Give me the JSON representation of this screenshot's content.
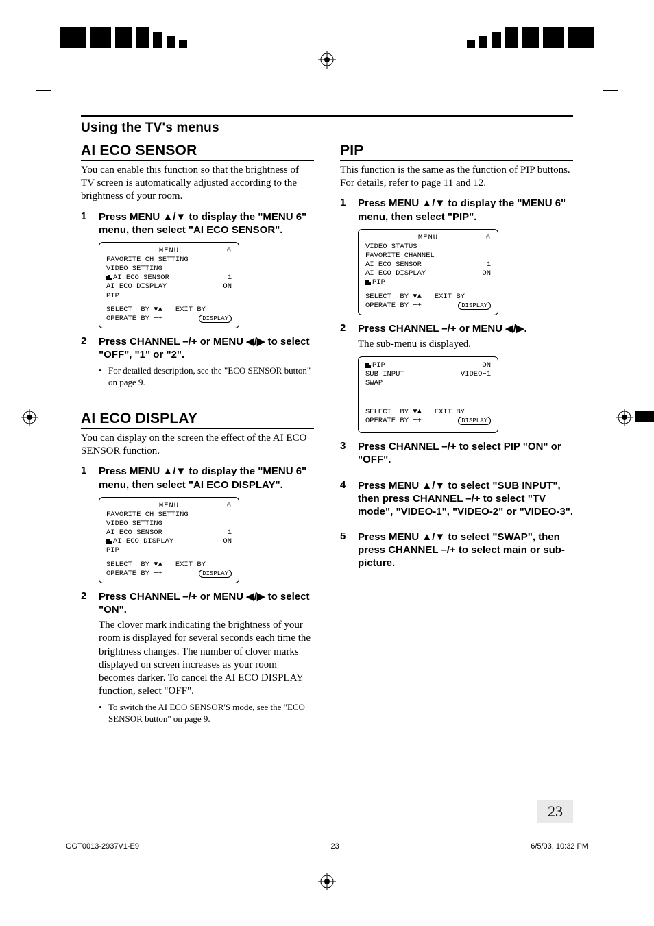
{
  "section_header": "Using the TV's menus",
  "left": {
    "ai_eco_sensor": {
      "title": "AI ECO SENSOR",
      "intro": "You can enable this function so that the brightness of TV screen is automatically adjusted according to the brightness of your room.",
      "step1": {
        "num": "1",
        "head": "Press MENU ▲/▼ to display the \"MENU 6\" menu, then select \"AI ECO SENSOR\"."
      },
      "osd1": {
        "title": "MENU",
        "page": "6",
        "items": [
          {
            "l": "FAVORITE CH SETTING",
            "r": ""
          },
          {
            "l": "VIDEO SETTING",
            "r": ""
          },
          {
            "l": "AI ECO SENSOR",
            "r": "1",
            "pointer": true
          },
          {
            "l": "AI ECO DISPLAY",
            "r": "ON"
          },
          {
            "l": "PIP",
            "r": ""
          }
        ],
        "foot1": "SELECT  BY ▼▲   EXIT BY",
        "foot2_l": "OPERATE BY −+",
        "foot2_r": "DISPLAY"
      },
      "step2": {
        "num": "2",
        "head": "Press CHANNEL –/+ or MENU ◀/▶ to select \"OFF\", \"1\" or \"2\"."
      },
      "bullet": "For detailed description, see the \"ECO SENSOR button\" on page 9."
    },
    "ai_eco_display": {
      "title": "AI ECO DISPLAY",
      "intro": "You can display on the screen the effect of the AI ECO SENSOR function.",
      "step1": {
        "num": "1",
        "head": "Press MENU ▲/▼ to display the \"MENU 6\" menu, then select \"AI ECO DISPLAY\"."
      },
      "osd1": {
        "title": "MENU",
        "page": "6",
        "items": [
          {
            "l": "FAVORITE CH SETTING",
            "r": ""
          },
          {
            "l": "VIDEO SETTING",
            "r": ""
          },
          {
            "l": "AI ECO SENSOR",
            "r": "1"
          },
          {
            "l": "AI ECO DISPLAY",
            "r": "ON",
            "pointer": true
          },
          {
            "l": "PIP",
            "r": ""
          }
        ],
        "foot1": "SELECT  BY ▼▲   EXIT BY",
        "foot2_l": "OPERATE BY −+",
        "foot2_r": "DISPLAY"
      },
      "step2": {
        "num": "2",
        "head": "Press CHANNEL –/+ or MENU ◀/▶ to select \"ON\".",
        "desc": "The clover mark indicating the brightness of your room is displayed for several seconds each time the brightness changes. The number of clover marks displayed on screen increases as your room becomes darker. To cancel the AI ECO DISPLAY function, select \"OFF\"."
      },
      "bullet": "To switch the AI ECO SENSOR'S mode, see the \"ECO SENSOR button\" on page 9."
    }
  },
  "right": {
    "pip": {
      "title": "PIP",
      "intro": "This function is the same as the function of PIP buttons. For details, refer to page 11 and 12.",
      "step1": {
        "num": "1",
        "head": "Press MENU ▲/▼ to display the \"MENU 6\" menu, then select \"PIP\"."
      },
      "osd1": {
        "title": "MENU",
        "page": "6",
        "items": [
          {
            "l": "VIDEO STATUS",
            "r": ""
          },
          {
            "l": "FAVORITE CHANNEL",
            "r": ""
          },
          {
            "l": "AI ECO SENSOR",
            "r": "1"
          },
          {
            "l": "AI ECO DISPLAY",
            "r": "ON"
          },
          {
            "l": "PIP",
            "r": "",
            "pointer": true
          }
        ],
        "foot1": "SELECT  BY ▼▲   EXIT BY",
        "foot2_l": "OPERATE BY −+",
        "foot2_r": "DISPLAY"
      },
      "step2": {
        "num": "2",
        "head": "Press CHANNEL –/+ or MENU ◀/▶.",
        "desc": "The sub-menu is displayed."
      },
      "osd2": {
        "items": [
          {
            "l": "PIP",
            "r": "ON",
            "pointer": true
          },
          {
            "l": "SUB INPUT",
            "r": "VIDEO−1"
          },
          {
            "l": "SWAP",
            "r": ""
          }
        ],
        "foot1": "SELECT  BY ▼▲   EXIT BY",
        "foot2_l": "OPERATE BY −+",
        "foot2_r": "DISPLAY"
      },
      "step3": {
        "num": "3",
        "head": "Press CHANNEL –/+ to select PIP \"ON\" or \"OFF\"."
      },
      "step4": {
        "num": "4",
        "head": "Press MENU ▲/▼ to select \"SUB INPUT\", then press CHANNEL –/+ to select \"TV mode\", \"VIDEO-1\", \"VIDEO-2\" or \"VIDEO-3\"."
      },
      "step5": {
        "num": "5",
        "head": "Press MENU ▲/▼ to select \"SWAP\", then press CHANNEL –/+ to select main or sub-picture."
      }
    }
  },
  "page_number": "23",
  "footer": {
    "left": "GGT0013-2937V1-E9",
    "center": "23",
    "right": "6/5/03, 10:32 PM"
  }
}
